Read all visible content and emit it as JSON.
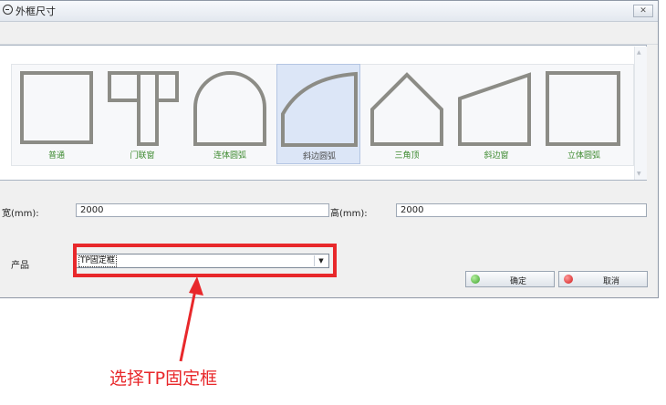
{
  "window": {
    "title": "外框尺寸",
    "close_glyph": "✕"
  },
  "shapes": [
    {
      "name": "shape-normal",
      "label": "普通",
      "selected": false
    },
    {
      "name": "shape-door-window",
      "label": "门联窗",
      "selected": false
    },
    {
      "name": "shape-continuous-arc",
      "label": "连体圆弧",
      "selected": false
    },
    {
      "name": "shape-oblique-arc",
      "label": "斜边圆弧",
      "selected": false
    },
    {
      "name": "shape-triangle-top",
      "label": "三角顶",
      "selected": false
    },
    {
      "name": "shape-oblique-window",
      "label": "斜边窗",
      "selected": false
    },
    {
      "name": "shape-3d-arc",
      "label": "立体圆弧",
      "selected": false
    }
  ],
  "form": {
    "width_label": "宽(mm):",
    "width_value": "2000",
    "height_label": "高(mm):",
    "height_value": "2000",
    "product_label": "产品",
    "product_value": "TP固定框"
  },
  "buttons": {
    "ok_label": "确定",
    "cancel_label": "取消"
  },
  "annotation": {
    "text": "选择TP固定框",
    "color": "#e8282b"
  },
  "colors": {
    "shape_stroke": "#8c8c86",
    "label_green": "#3d8a2f",
    "selected_bg": "#dce6f7",
    "highlight_red": "#e8282b"
  }
}
